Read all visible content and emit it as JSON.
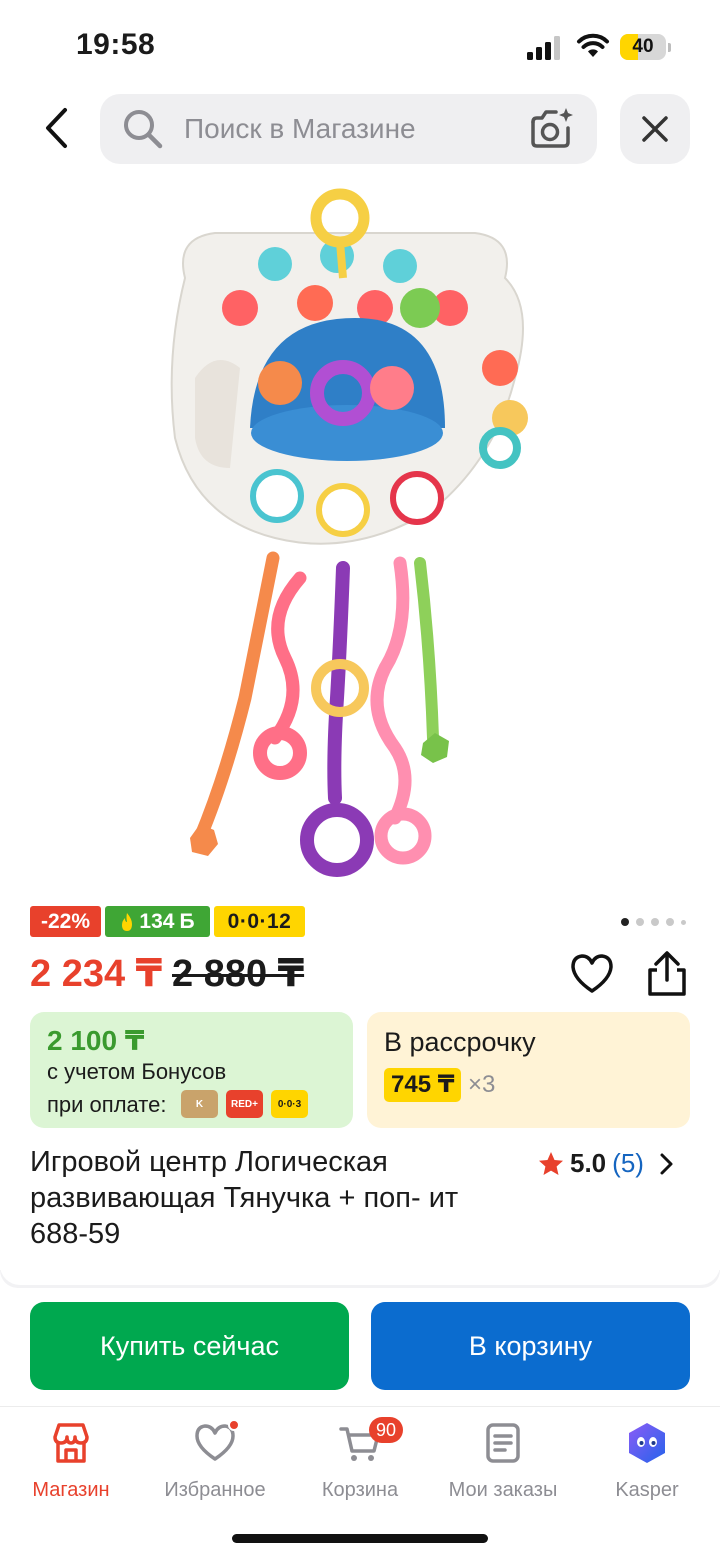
{
  "status_bar": {
    "time": "19:58",
    "battery_level": "40",
    "battery_fraction": 0.4
  },
  "search": {
    "placeholder": "Поиск в Магазине",
    "icons": [
      "back-arrow-icon",
      "search-icon",
      "camera-icon",
      "close-icon"
    ]
  },
  "product": {
    "image_alt": "pull-string sensory toy",
    "badges": {
      "discount": "-22%",
      "bonus": "134",
      "bonus_currency": "Б",
      "installment": "0·0·12"
    },
    "gallery": {
      "total": 5,
      "active_index": 0
    },
    "price": {
      "current": "2 234 ₸",
      "old": "2 880 ₸"
    },
    "bonus_card": {
      "amount": "2 100 ₸",
      "line1": "с учетом Бонусов",
      "line2": "при оплате:",
      "pay_methods": [
        "K",
        "RED+",
        "0·0·3"
      ]
    },
    "installment_card": {
      "title": "В рассрочку",
      "amount": "745 ₸",
      "times": "×3"
    },
    "title": "Игровой центр Логическая развивающая Тянучка + поп- ит 688-59",
    "rating": {
      "value": "5.0",
      "count": "(5)"
    }
  },
  "actions": {
    "buy_now": "Купить сейчас",
    "add_to_cart": "В корзину"
  },
  "bottom_nav": {
    "items": [
      {
        "label": "Магазин",
        "icon": "store-icon",
        "active": true
      },
      {
        "label": "Избранное",
        "icon": "heart-icon"
      },
      {
        "label": "Корзина",
        "icon": "cart-icon",
        "badge": "90"
      },
      {
        "label": "Мои заказы",
        "icon": "orders-icon"
      },
      {
        "label": "Kasper",
        "icon": "kasper-assistant-icon"
      }
    ]
  },
  "colors": {
    "accent_red": "#e8412c",
    "buy_green": "#00a84f",
    "cart_blue": "#0b6ccf",
    "installment_yellow": "#ffd500",
    "bonus_green": "#3fa635"
  }
}
